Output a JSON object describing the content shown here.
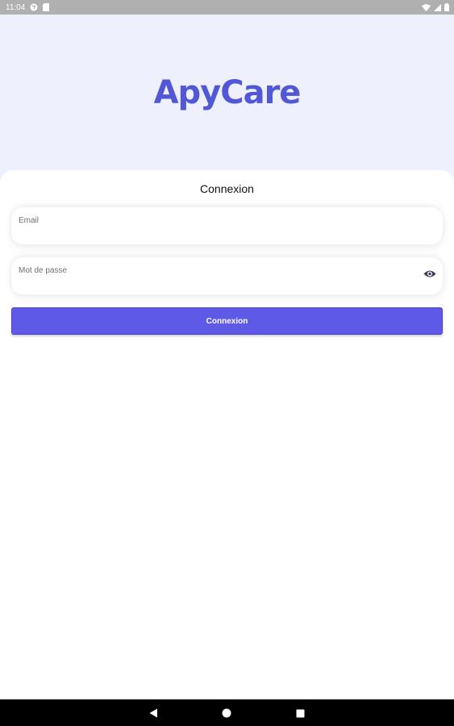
{
  "status_bar": {
    "time": "11:04",
    "icons": [
      "app-notification-icon",
      "sd-card-icon",
      "wifi-icon",
      "signal-icon",
      "battery-icon"
    ]
  },
  "header": {
    "app_title": "ApyCare"
  },
  "login_form": {
    "title": "Connexion",
    "email": {
      "label": "Email",
      "value": ""
    },
    "password": {
      "label": "Mot de passe",
      "value": "",
      "toggle_icon": "eye-icon"
    },
    "submit_label": "Connexion"
  },
  "nav_bar": {
    "buttons": [
      "back-icon",
      "home-icon",
      "recents-icon"
    ]
  },
  "colors": {
    "brand": "#5257d6",
    "button": "#5f59e8",
    "header_bg": "#eff0fd"
  }
}
